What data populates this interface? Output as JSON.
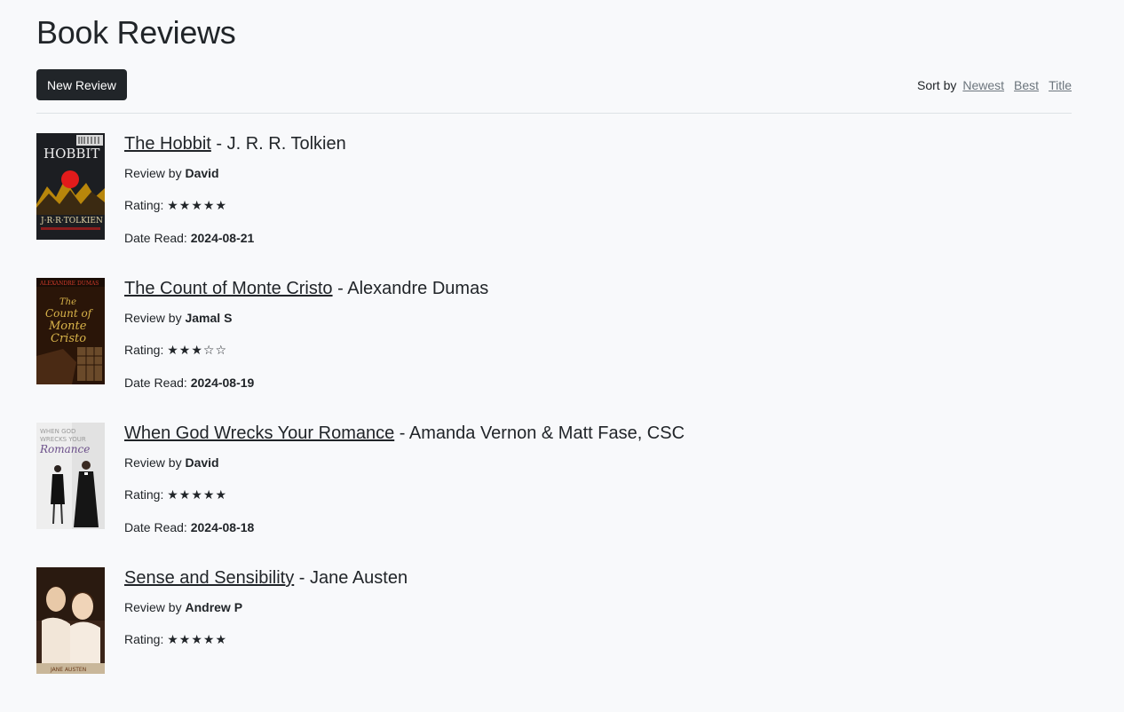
{
  "page_title": "Book Reviews",
  "toolbar": {
    "new_review_label": "New Review",
    "sort_label": "Sort by",
    "sort_options": [
      "Newest",
      "Best",
      "Title"
    ]
  },
  "labels": {
    "review_by": "Review by",
    "rating": "Rating:",
    "date_read": "Date Read:"
  },
  "reviews": [
    {
      "title": "The Hobbit",
      "author": "J. R. R. Tolkien",
      "reviewer": "David",
      "rating": 5,
      "stars": "★★★★★",
      "date_read": "2024-08-21",
      "cover_icon": "hobbit-cover-image",
      "cover_text": "THE HOBBIT",
      "cover_author": "J.R.R. TOLKIEN"
    },
    {
      "title": "The Count of Monte Cristo",
      "author": "Alexandre Dumas",
      "reviewer": "Jamal S",
      "rating": 3,
      "stars": "★★★☆☆",
      "date_read": "2024-08-19",
      "cover_icon": "monte-cristo-cover-image",
      "cover_text": "ALEXANDRE DUMAS",
      "cover_author": "The Count of Monte Cristo"
    },
    {
      "title": "When God Wrecks Your Romance",
      "author": "Amanda Vernon & Matt Fase, CSC",
      "reviewer": "David",
      "rating": 5,
      "stars": "★★★★★",
      "date_read": "2024-08-18",
      "cover_icon": "romance-cover-image",
      "cover_text": "WHEN GOD WRECKS YOUR",
      "cover_author": "Romance"
    },
    {
      "title": "Sense and Sensibility",
      "author": "Jane Austen",
      "reviewer": "Andrew P",
      "rating": 5,
      "stars": "★★★★★",
      "date_read": "",
      "cover_icon": "sense-sensibility-cover-image",
      "cover_text": "",
      "cover_author": "JANE AUSTEN"
    }
  ]
}
